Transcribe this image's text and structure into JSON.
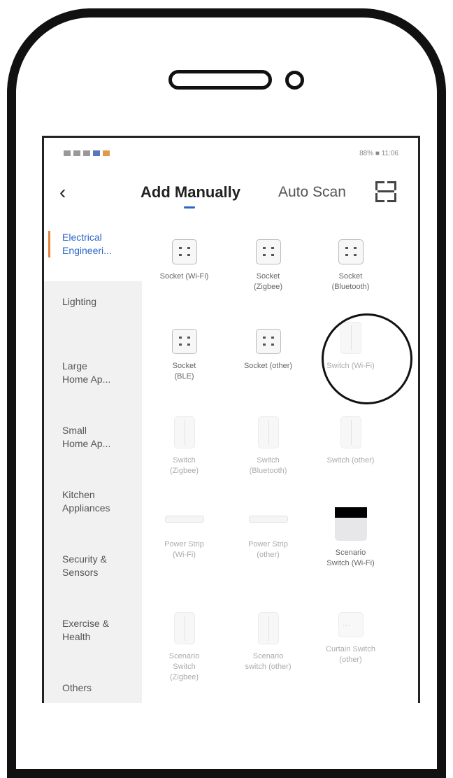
{
  "status": {
    "left_text": "",
    "right_text": "88% ■ 11:06"
  },
  "header": {
    "back_icon": "chevron-left-icon",
    "tab_manual": "Add Manually",
    "tab_auto": "Auto Scan",
    "scan_icon": "scan-icon"
  },
  "sidebar": {
    "items": [
      {
        "label": "Electrical\nEngineeri..."
      },
      {
        "label": "Lighting"
      },
      {
        "label": "Large\nHome Ap..."
      },
      {
        "label": "Small\nHome Ap..."
      },
      {
        "label": "Kitchen\nAppliances"
      },
      {
        "label": "Security &\nSensors"
      },
      {
        "label": "Exercise &\nHealth"
      },
      {
        "label": "Others"
      }
    ]
  },
  "devices": [
    {
      "name": "Socket (Wi-Fi)"
    },
    {
      "name": "Socket\n(Zigbee)"
    },
    {
      "name": "Socket\n(Bluetooth)"
    },
    {
      "name": "Socket\n(BLE)"
    },
    {
      "name": "Socket (other)"
    },
    {
      "name": "Switch (Wi-Fi)"
    },
    {
      "name": "Switch\n(Zigbee)"
    },
    {
      "name": "Switch\n(Bluetooth)"
    },
    {
      "name": "Switch (other)"
    },
    {
      "name": "Power Strip\n(Wi-Fi)"
    },
    {
      "name": "Power Strip\n(other)"
    },
    {
      "name": "Scenario\nSwitch (Wi-Fi)"
    },
    {
      "name": "Scenario\nSwitch\n(Zigbee)"
    },
    {
      "name": "Scenario\nswitch (other)"
    },
    {
      "name": "Curtain Switch\n(other)"
    }
  ]
}
